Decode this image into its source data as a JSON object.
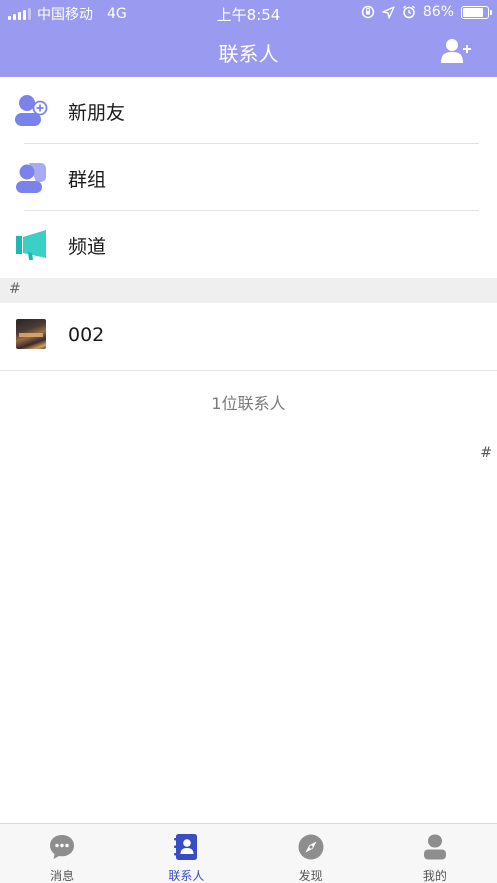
{
  "status_bar": {
    "carrier": "中国移动",
    "network": "4G",
    "time": "上午8:54",
    "battery_percent": "86%",
    "battery_level": 0.86
  },
  "nav": {
    "title": "联系人",
    "add_icon": "add-contact-icon"
  },
  "menu": [
    {
      "label": "新朋友",
      "icon": "new-friend-icon"
    },
    {
      "label": "群组",
      "icon": "group-icon"
    },
    {
      "label": "频道",
      "icon": "channel-icon"
    }
  ],
  "section": {
    "header": "#"
  },
  "contacts": [
    {
      "name": "002",
      "icon": "avatar"
    }
  ],
  "contact_count": "1位联系人",
  "index_bar": [
    "#"
  ],
  "tabs": [
    {
      "label": "消息",
      "icon": "chat-icon",
      "active": false
    },
    {
      "label": "联系人",
      "icon": "contacts-book-icon",
      "active": true
    },
    {
      "label": "发现",
      "icon": "compass-icon",
      "active": false
    },
    {
      "label": "我的",
      "icon": "person-icon",
      "active": false
    }
  ],
  "colors": {
    "header_bg": "#9a9af0",
    "icon_accent": "#7b83ea",
    "channel_accent": "#3ccfc6",
    "tab_active": "#3a4cc4",
    "tab_inactive": "#8e8e8e"
  }
}
